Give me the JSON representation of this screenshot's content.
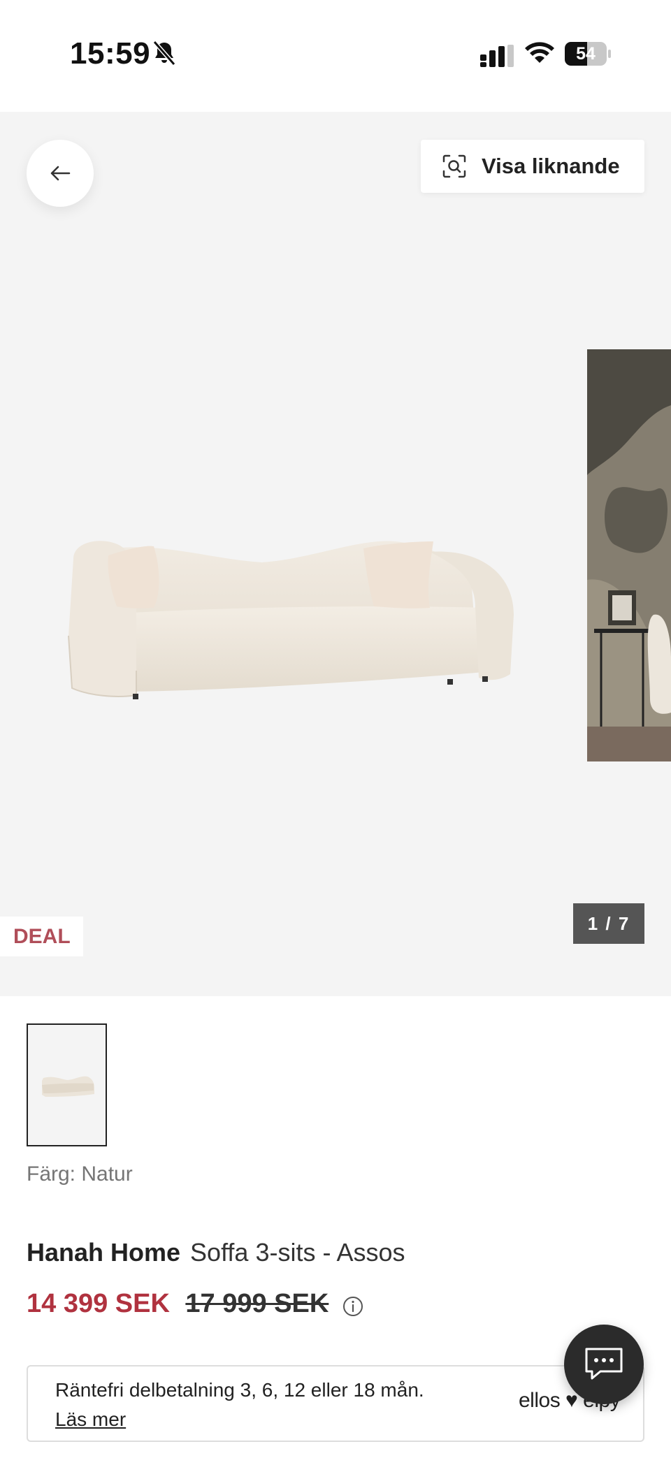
{
  "status_bar": {
    "time": "15:59",
    "battery": "54",
    "battery_level": 0.54
  },
  "gallery": {
    "similar_label": "Visa liknande",
    "pager": "1 / 7",
    "badge": "DEAL",
    "current_image": 1,
    "total_images": 7
  },
  "product": {
    "color_label": "Färg: Natur",
    "brand": "Hanah Home",
    "name": "Soffa 3-sits - Assos",
    "price_now": "14 399 SEK",
    "price_old": "17 999 SEK"
  },
  "finance": {
    "text": "Räntefri delbetalning 3, 6, 12 eller 18 mån.",
    "link": "Läs mer",
    "logo": "ellos ♥ elpy"
  },
  "colors": {
    "sale_red": "#b0323f",
    "badge_red": "#b04e59",
    "gallery_bg": "#f4f4f4",
    "chat_bg": "#2b2b2b"
  },
  "icons": [
    "bell-off-icon",
    "signal-icon",
    "wifi-icon",
    "battery-icon",
    "back-arrow-icon",
    "visual-search-icon",
    "info-icon",
    "chat-icon"
  ]
}
